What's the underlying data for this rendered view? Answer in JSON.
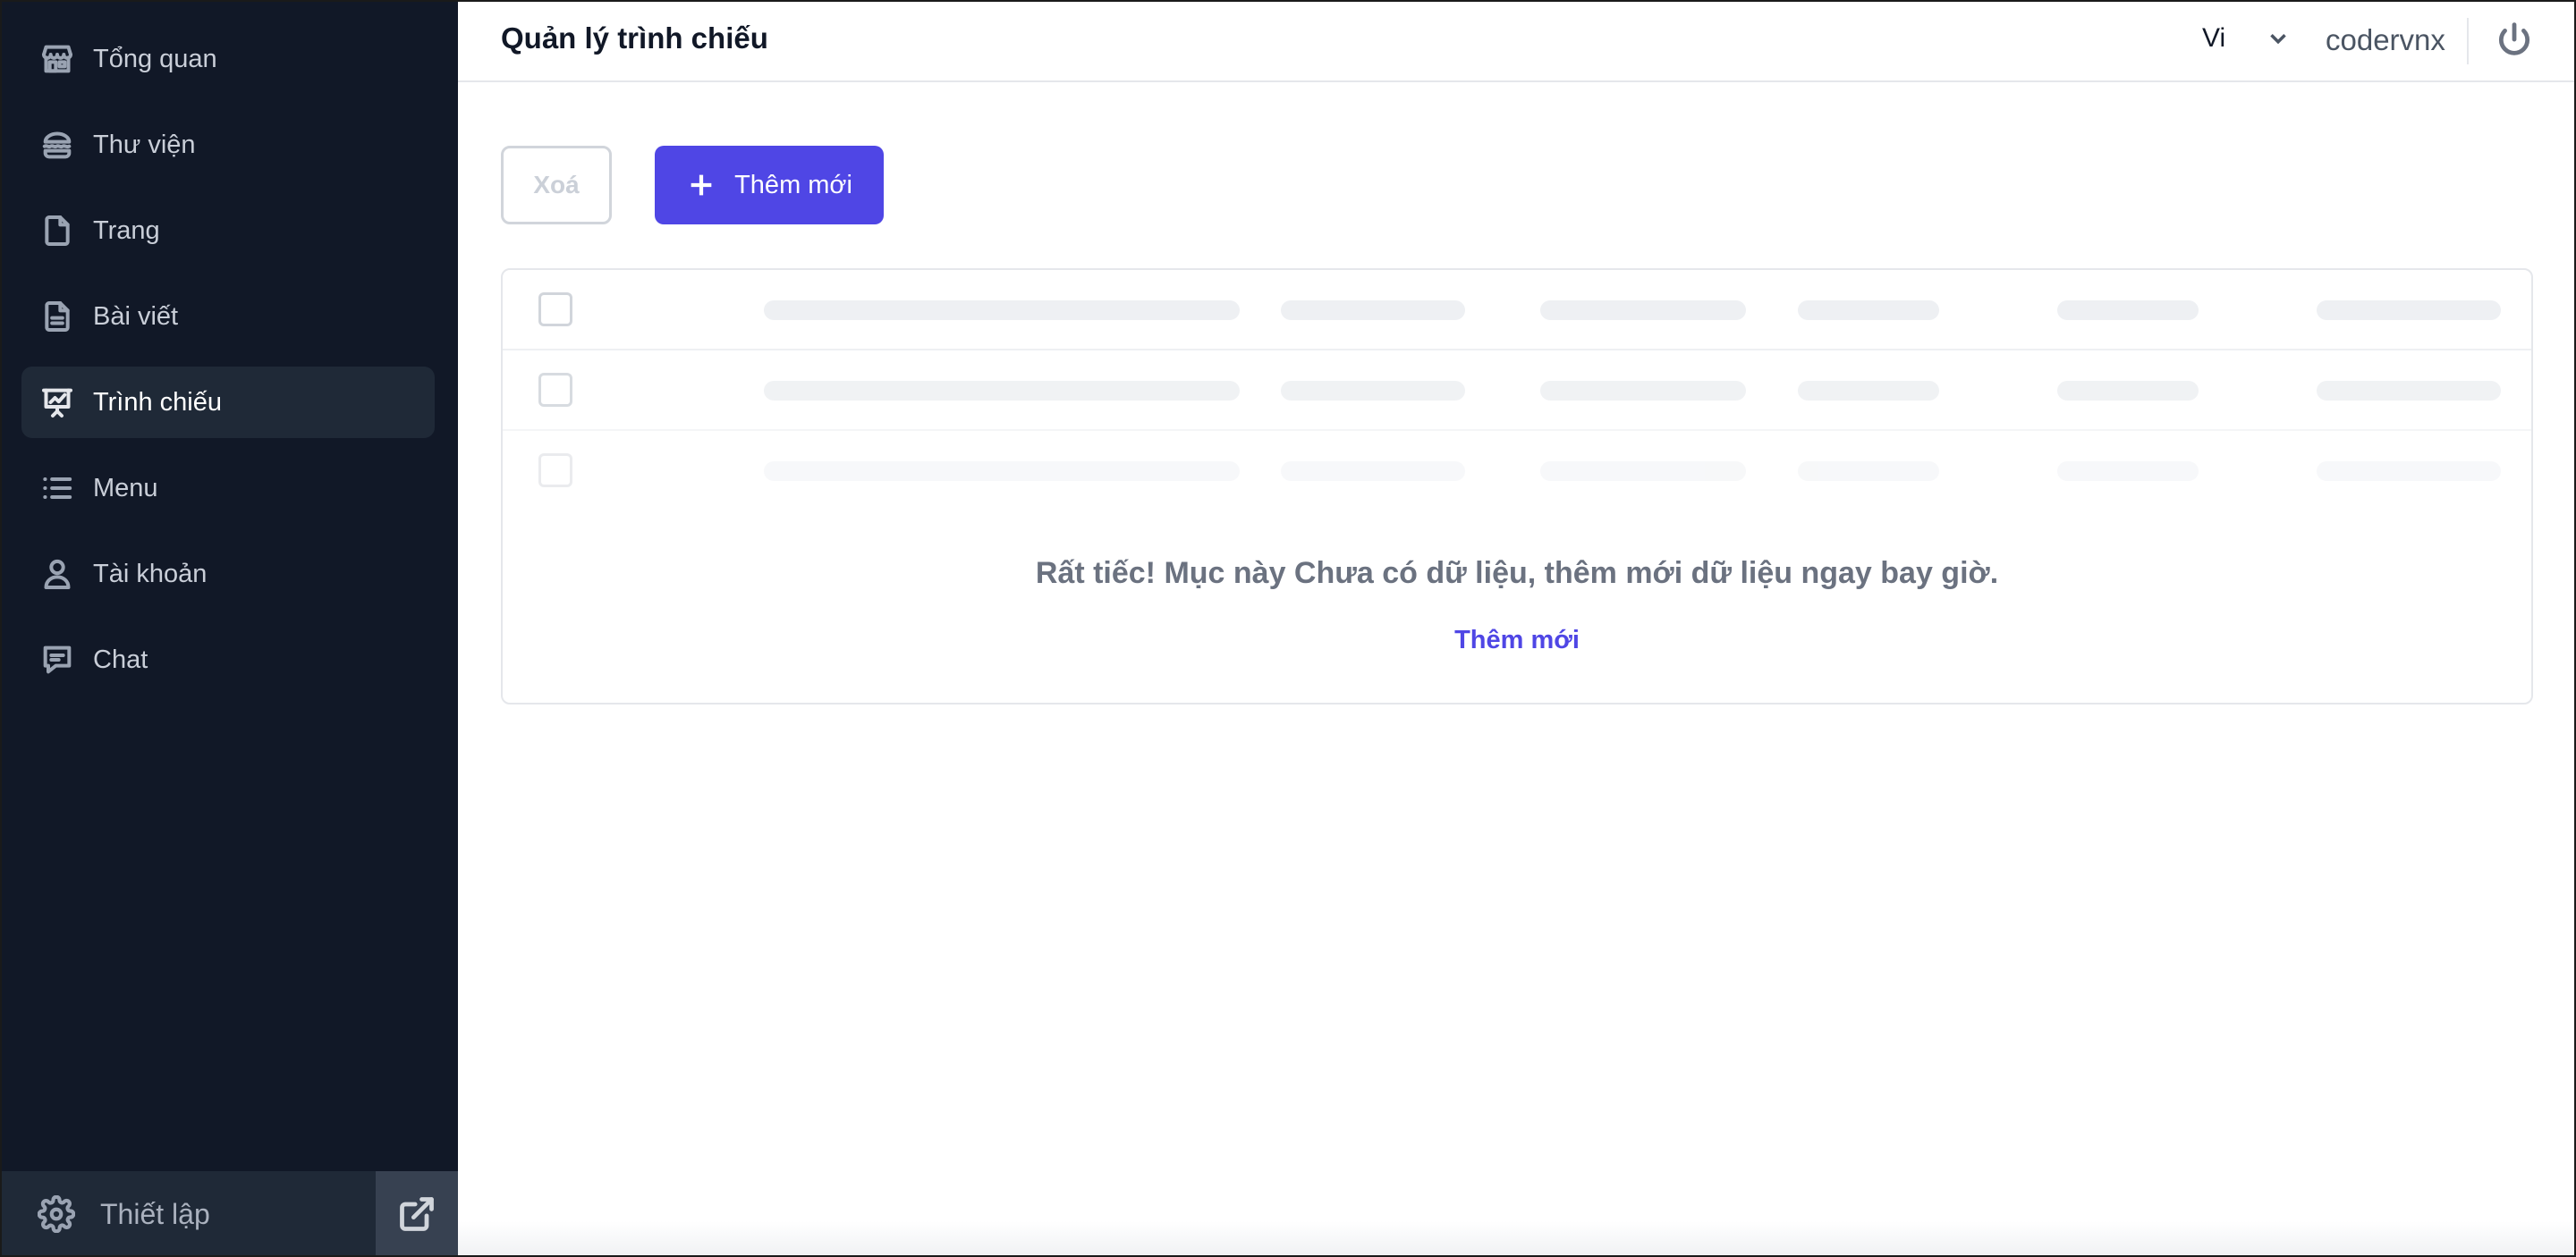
{
  "sidebar": {
    "items": [
      {
        "label": "Tổng quan",
        "icon": "store-icon",
        "active": false
      },
      {
        "label": "Thư viện",
        "icon": "hamburger-icon",
        "active": false
      },
      {
        "label": "Trang",
        "icon": "file-icon",
        "active": false
      },
      {
        "label": "Bài viết",
        "icon": "document-text-icon",
        "active": false
      },
      {
        "label": "Trình chiếu",
        "icon": "presentation-chart-icon",
        "active": true
      },
      {
        "label": "Menu",
        "icon": "list-icon",
        "active": false
      },
      {
        "label": "Tài khoản",
        "icon": "user-icon",
        "active": false
      },
      {
        "label": "Chat",
        "icon": "chat-icon",
        "active": false
      }
    ],
    "settings_label": "Thiết lập",
    "settings_icon": "gear-icon",
    "external_icon": "external-link-icon"
  },
  "header": {
    "title": "Quản lý trình chiếu",
    "language": "Vi",
    "username": "codervnx",
    "power_icon": "power-icon"
  },
  "toolbar": {
    "delete_label": "Xoá",
    "add_label": "Thêm mới"
  },
  "table": {
    "empty_message": "Rất tiếc! Mục này Chưa có dữ liệu, thêm mới dữ liệu ngay bay giờ.",
    "empty_add_label": "Thêm mới"
  },
  "colors": {
    "sidebar_bg": "#111827",
    "sidebar_active": "#1f2937",
    "accent": "#4f46e5"
  }
}
